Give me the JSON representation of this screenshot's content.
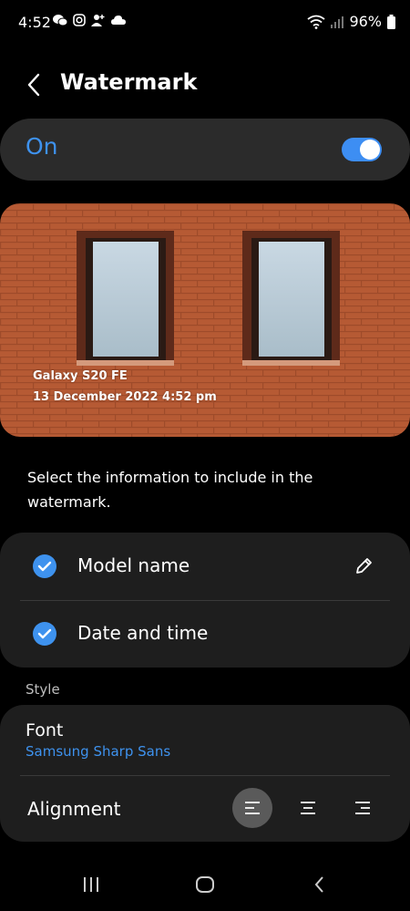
{
  "status": {
    "time": "4:52",
    "battery": "96%"
  },
  "header": {
    "title": "Watermark"
  },
  "toggle": {
    "label": "On",
    "state": "on"
  },
  "preview": {
    "model": "Galaxy S20 FE",
    "datetime": "13 December 2022 4:52 pm"
  },
  "description": "Select the information to include in the watermark.",
  "options": [
    {
      "label": "Model name",
      "checked": true
    },
    {
      "label": "Date and time",
      "checked": true
    }
  ],
  "style": {
    "section_label": "Style",
    "font_label": "Font",
    "font_value": "Samsung Sharp Sans",
    "alignment_label": "Alignment",
    "alignment_selected": "left"
  },
  "colors": {
    "accent": "#3e92ee",
    "card": "#1e1e1e",
    "onbar": "#2b2b2b"
  }
}
